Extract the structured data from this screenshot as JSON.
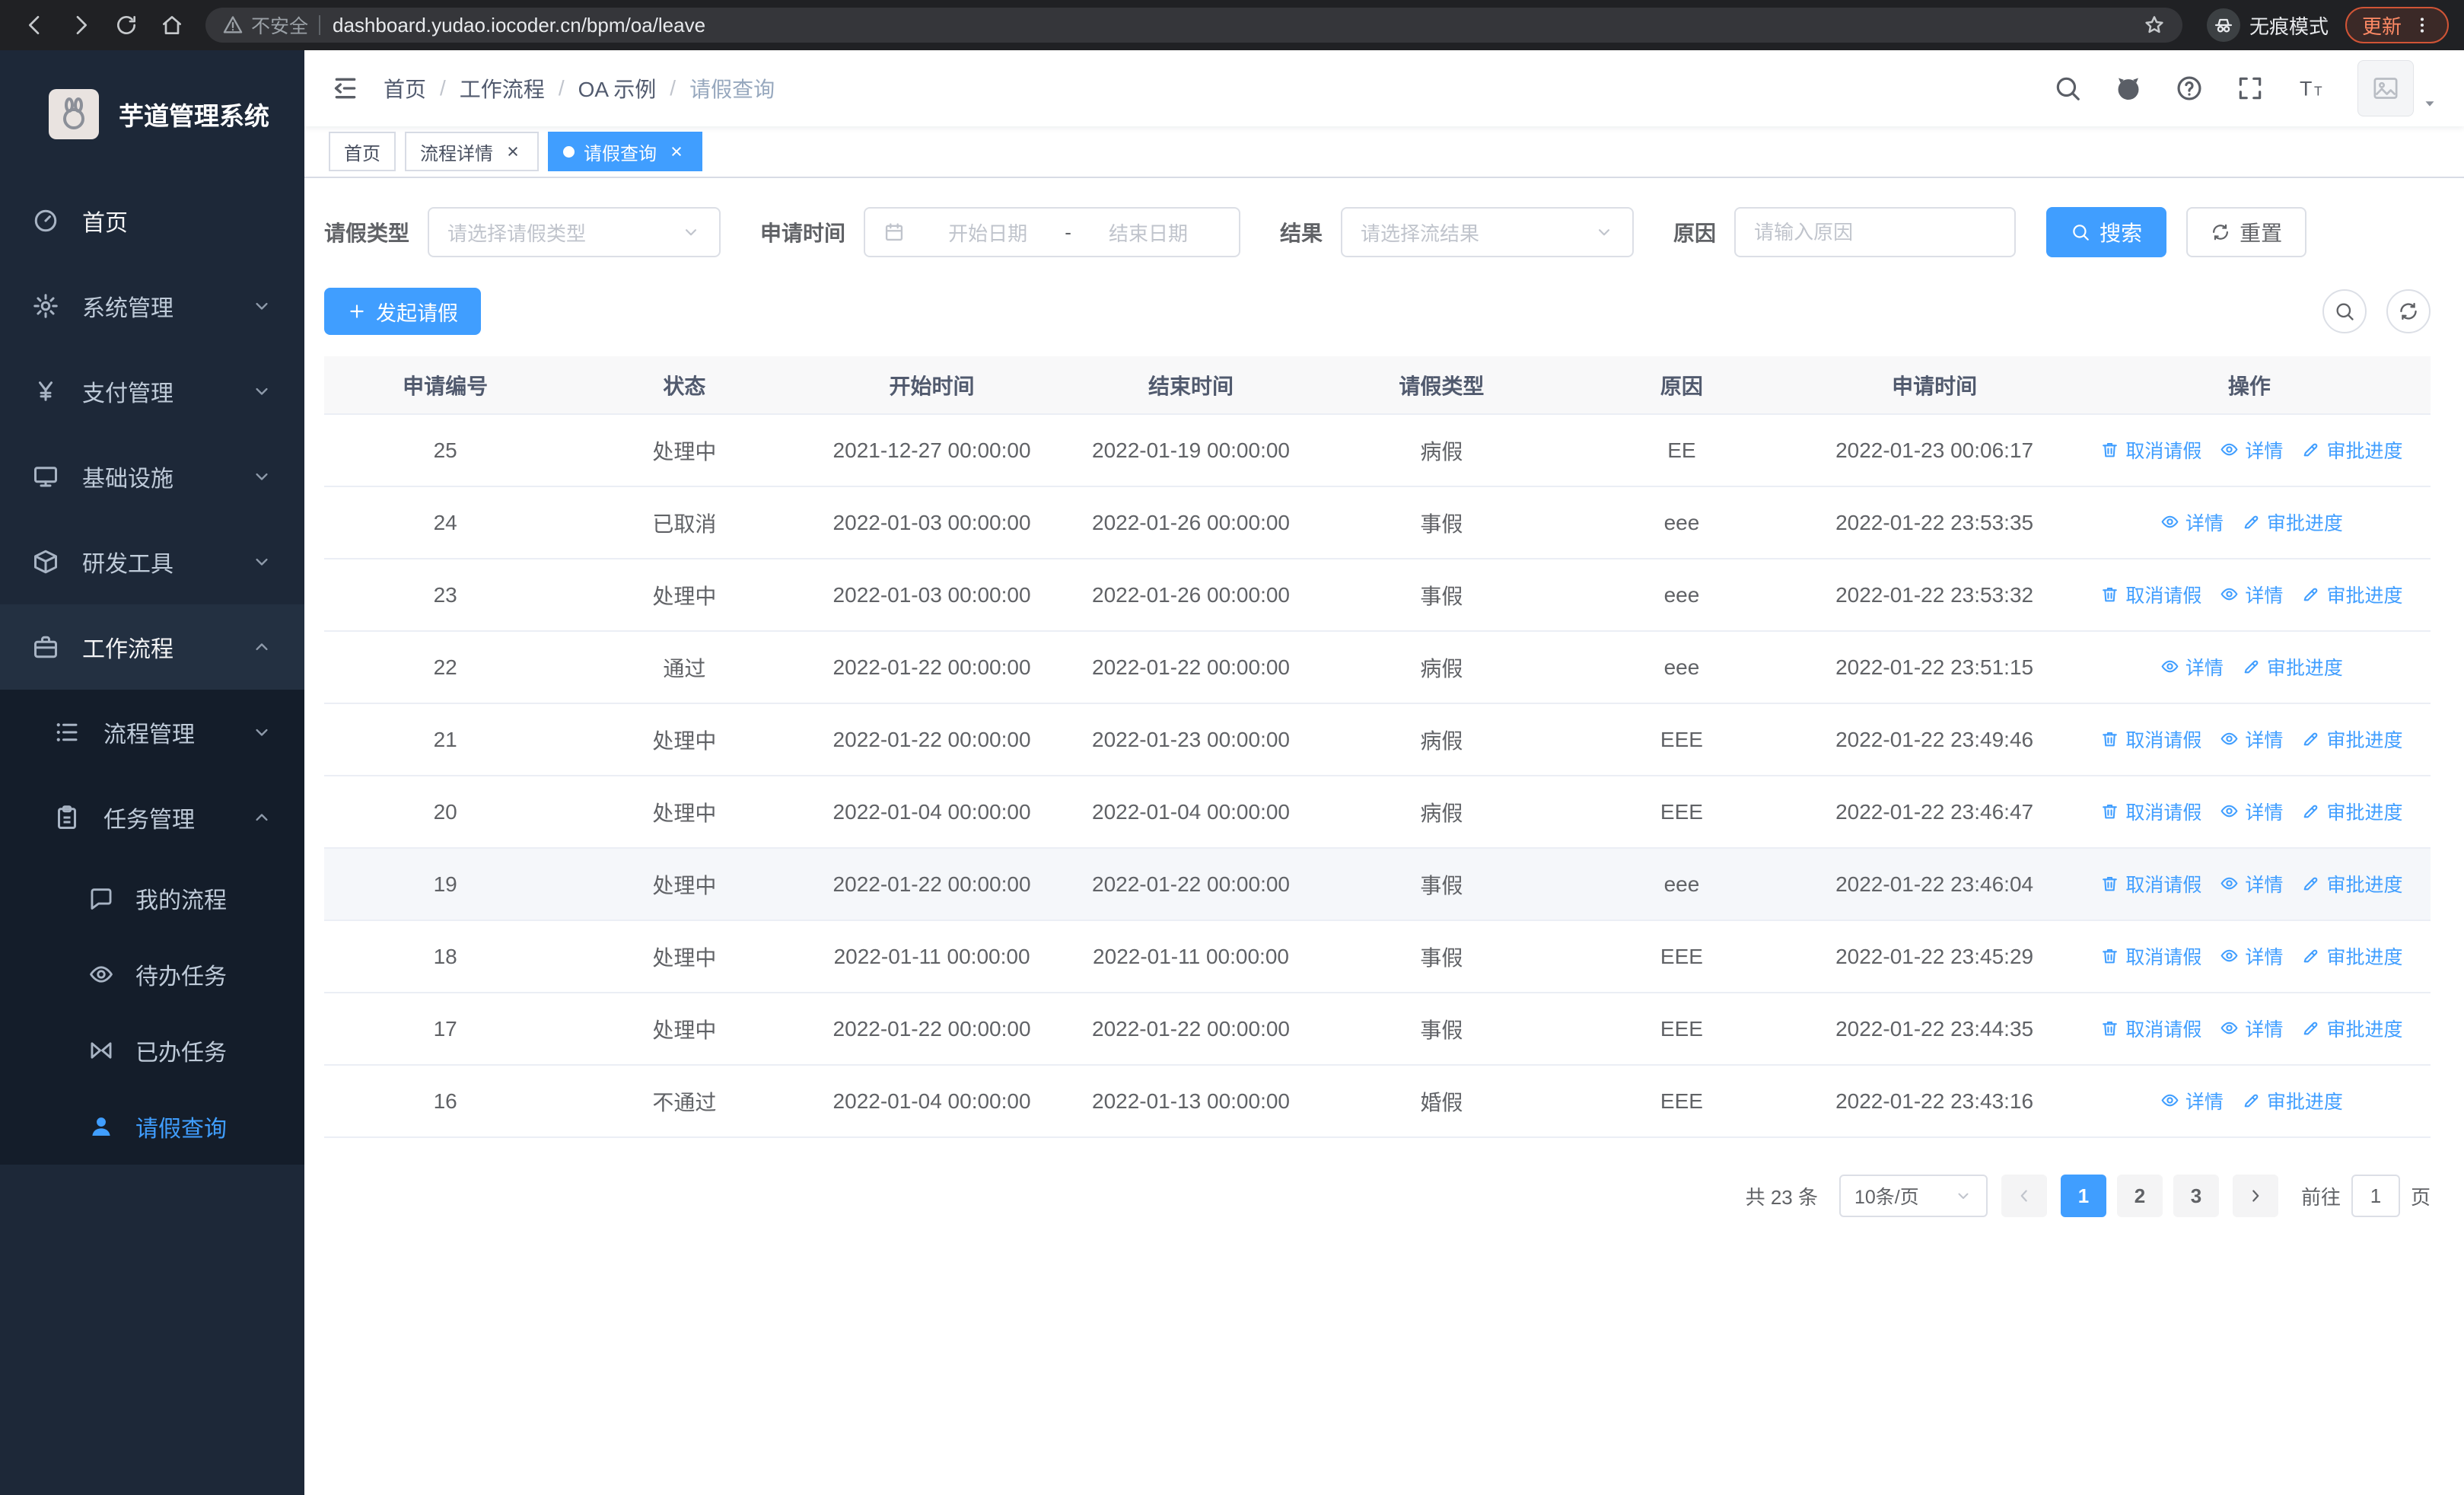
{
  "browser": {
    "security_label": "不安全",
    "url": "dashboard.yudao.iocoder.cn/bpm/oa/leave",
    "incognito_label": "无痕模式",
    "update_label": "更新"
  },
  "sidebar": {
    "logo_title": "芋道管理系统",
    "items": [
      {
        "label": "首页",
        "icon": "dashboard-icon"
      },
      {
        "label": "系统管理",
        "icon": "gear-icon"
      },
      {
        "label": "支付管理",
        "icon": "yen-icon"
      },
      {
        "label": "基础设施",
        "icon": "monitor-icon"
      },
      {
        "label": "研发工具",
        "icon": "cube-icon"
      },
      {
        "label": "工作流程",
        "icon": "briefcase-icon"
      }
    ],
    "process_mgmt_label": "流程管理",
    "task_mgmt_label": "任务管理",
    "task_children": [
      {
        "label": "我的流程",
        "icon": "chat-icon"
      },
      {
        "label": "待办任务",
        "icon": "eye-icon"
      },
      {
        "label": "已办任务",
        "icon": "bowtie-icon"
      },
      {
        "label": "请假查询",
        "icon": "user-icon",
        "active": true
      }
    ]
  },
  "header": {
    "breadcrumb": [
      "首页",
      "工作流程",
      "OA 示例",
      "请假查询"
    ]
  },
  "tabs": [
    {
      "label": "首页"
    },
    {
      "label": "流程详情",
      "closable": true
    },
    {
      "label": "请假查询",
      "closable": true,
      "active": true
    }
  ],
  "filters": {
    "leave_type_label": "请假类型",
    "leave_type_placeholder": "请选择请假类型",
    "apply_time_label": "申请时间",
    "start_placeholder": "开始日期",
    "range_separator": "-",
    "end_placeholder": "结束日期",
    "result_label": "结果",
    "result_placeholder": "请选择流结果",
    "reason_label": "原因",
    "reason_placeholder": "请输入原因",
    "search_label": "搜索",
    "reset_label": "重置"
  },
  "toolbar": {
    "create_label": "发起请假"
  },
  "table": {
    "columns": [
      "申请编号",
      "状态",
      "开始时间",
      "结束时间",
      "请假类型",
      "原因",
      "申请时间",
      "操作"
    ],
    "row_keys": [
      "id",
      "status",
      "start",
      "end",
      "type",
      "reason",
      "applied"
    ],
    "action_labels": {
      "cancel": "取消请假",
      "detail": "详情",
      "progress": "审批进度"
    },
    "rows": [
      {
        "id": "25",
        "status": "处理中",
        "start": "2021-12-27 00:00:00",
        "end": "2022-01-19 00:00:00",
        "type": "病假",
        "reason": "EE",
        "applied": "2022-01-23 00:06:17",
        "actions": [
          "cancel",
          "detail",
          "progress"
        ]
      },
      {
        "id": "24",
        "status": "已取消",
        "start": "2022-01-03 00:00:00",
        "end": "2022-01-26 00:00:00",
        "type": "事假",
        "reason": "eee",
        "applied": "2022-01-22 23:53:35",
        "actions": [
          "detail",
          "progress"
        ]
      },
      {
        "id": "23",
        "status": "处理中",
        "start": "2022-01-03 00:00:00",
        "end": "2022-01-26 00:00:00",
        "type": "事假",
        "reason": "eee",
        "applied": "2022-01-22 23:53:32",
        "actions": [
          "cancel",
          "detail",
          "progress"
        ]
      },
      {
        "id": "22",
        "status": "通过",
        "start": "2022-01-22 00:00:00",
        "end": "2022-01-22 00:00:00",
        "type": "病假",
        "reason": "eee",
        "applied": "2022-01-22 23:51:15",
        "actions": [
          "detail",
          "progress"
        ]
      },
      {
        "id": "21",
        "status": "处理中",
        "start": "2022-01-22 00:00:00",
        "end": "2022-01-23 00:00:00",
        "type": "病假",
        "reason": "EEE",
        "applied": "2022-01-22 23:49:46",
        "actions": [
          "cancel",
          "detail",
          "progress"
        ]
      },
      {
        "id": "20",
        "status": "处理中",
        "start": "2022-01-04 00:00:00",
        "end": "2022-01-04 00:00:00",
        "type": "病假",
        "reason": "EEE",
        "applied": "2022-01-22 23:46:47",
        "actions": [
          "cancel",
          "detail",
          "progress"
        ]
      },
      {
        "id": "19",
        "status": "处理中",
        "start": "2022-01-22 00:00:00",
        "end": "2022-01-22 00:00:00",
        "type": "事假",
        "reason": "eee",
        "applied": "2022-01-22 23:46:04",
        "actions": [
          "cancel",
          "detail",
          "progress"
        ],
        "highlighted": true
      },
      {
        "id": "18",
        "status": "处理中",
        "start": "2022-01-11 00:00:00",
        "end": "2022-01-11 00:00:00",
        "type": "事假",
        "reason": "EEE",
        "applied": "2022-01-22 23:45:29",
        "actions": [
          "cancel",
          "detail",
          "progress"
        ]
      },
      {
        "id": "17",
        "status": "处理中",
        "start": "2022-01-22 00:00:00",
        "end": "2022-01-22 00:00:00",
        "type": "事假",
        "reason": "EEE",
        "applied": "2022-01-22 23:44:35",
        "actions": [
          "cancel",
          "detail",
          "progress"
        ]
      },
      {
        "id": "16",
        "status": "不通过",
        "start": "2022-01-04 00:00:00",
        "end": "2022-01-13 00:00:00",
        "type": "婚假",
        "reason": "EEE",
        "applied": "2022-01-22 23:43:16",
        "actions": [
          "detail",
          "progress"
        ]
      }
    ]
  },
  "pagination": {
    "total_label": "共 23 条",
    "page_size_label": "10条/页",
    "pages": [
      "1",
      "2",
      "3"
    ],
    "active_page": "1",
    "goto_label": "前往",
    "goto_value": "1",
    "goto_suffix": "页"
  },
  "colors": {
    "primary": "#409eff",
    "sidebar_bg": "#1d2838",
    "submenu_bg": "#141d2a",
    "active_tab_bg": "#409eff"
  }
}
